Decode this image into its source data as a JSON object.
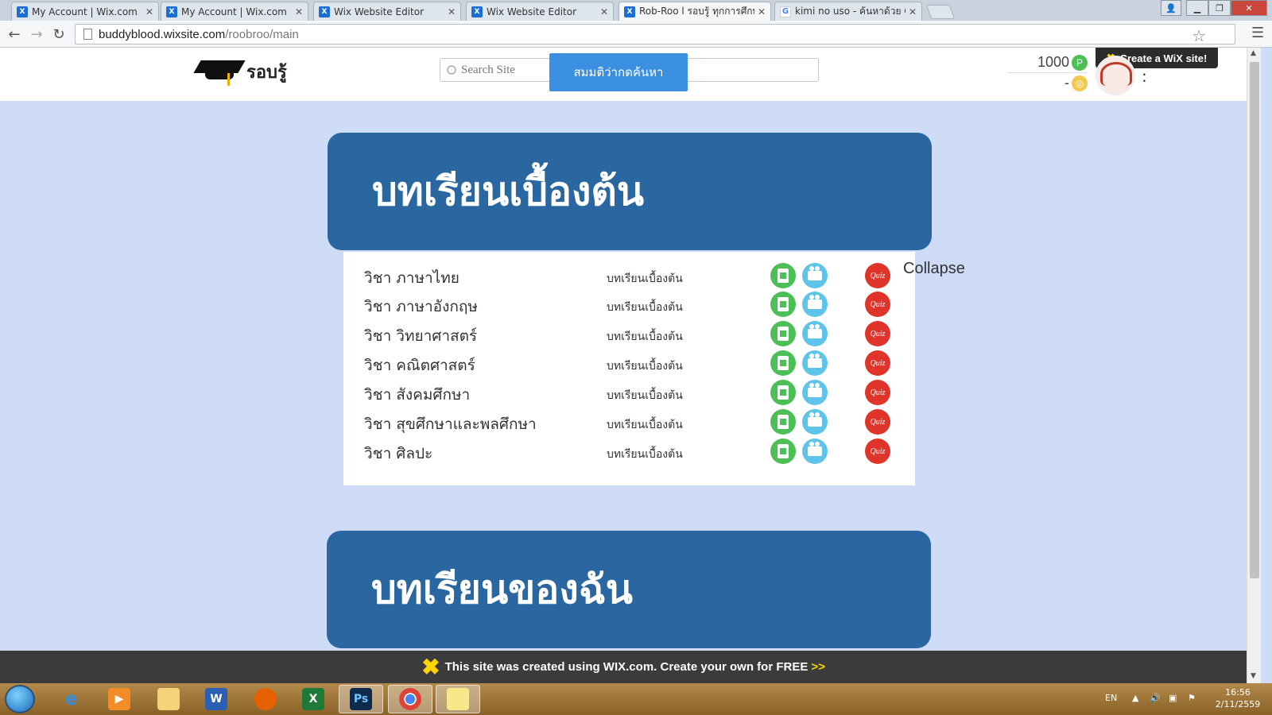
{
  "browser": {
    "tabs": [
      {
        "title": "My Account | Wix.com",
        "icon": "wix-favicon"
      },
      {
        "title": "My Account | Wix.com",
        "icon": "wix-favicon"
      },
      {
        "title": "Wix Website Editor",
        "icon": "wix-favicon"
      },
      {
        "title": "Wix Website Editor",
        "icon": "wix-favicon"
      },
      {
        "title": "Rob-Roo l รอบรู้ ทุกการศึกษ",
        "icon": "wix-favicon",
        "active": true
      },
      {
        "title": "kimi no uso - ค้นหาด้วย Go",
        "icon": "google-favicon"
      }
    ],
    "url_host": "buddyblood.wixsite.com",
    "url_path": "/roobroo/main"
  },
  "header": {
    "logo_text": "รอบรู้",
    "search_placeholder": "Search Site",
    "search_button": "สมมติว่ากดค้นหา",
    "points": "1000",
    "coins": "-",
    "point_icon_letter": "P",
    "create_badge": "Create a WiX site!",
    "avatar_menu": ":"
  },
  "sections": [
    {
      "title": "บทเรียนเบื้องต้น"
    },
    {
      "title": "บทเรียนของฉัน"
    }
  ],
  "courses": [
    {
      "name": "วิชา ภาษาไทย",
      "level": "บทเรียนเบื้องต้น"
    },
    {
      "name": "วิชา ภาษาอังกฤษ",
      "level": "บทเรียนเบื้องต้น"
    },
    {
      "name": "วิชา วิทยาศาสตร์",
      "level": "บทเรียนเบื้องต้น"
    },
    {
      "name": "วิชา คณิตศาสตร์",
      "level": "บทเรียนเบื้องต้น"
    },
    {
      "name": "วิชา สังคมศึกษา",
      "level": "บทเรียนเบื้องต้น"
    },
    {
      "name": "วิชา สุขศึกษาและพลศึกษา",
      "level": "บทเรียนเบื้องต้น"
    },
    {
      "name": "วิชา ศิลปะ",
      "level": "บทเรียนเบื้องต้น"
    }
  ],
  "quiz_label": "Quiz",
  "collapse_label": "Collapse",
  "wix_footer": {
    "message": "This site was created using WIX.com. Create your own for FREE",
    "arrows": ">>"
  },
  "taskbar": {
    "apps": [
      "ie",
      "media-player",
      "explorer",
      "word",
      "firefox",
      "excel",
      "photoshop",
      "chrome",
      "sticky-notes"
    ],
    "language": "EN",
    "time": "16:56",
    "date": "2/11/2559"
  },
  "colors": {
    "banner": "#2a67a1",
    "page_bg": "#cfdcf8",
    "search_button": "#3b8fe0",
    "doc_icon": "#4cbf56",
    "video_icon": "#5ec4ea",
    "quiz_icon": "#e0342a"
  }
}
